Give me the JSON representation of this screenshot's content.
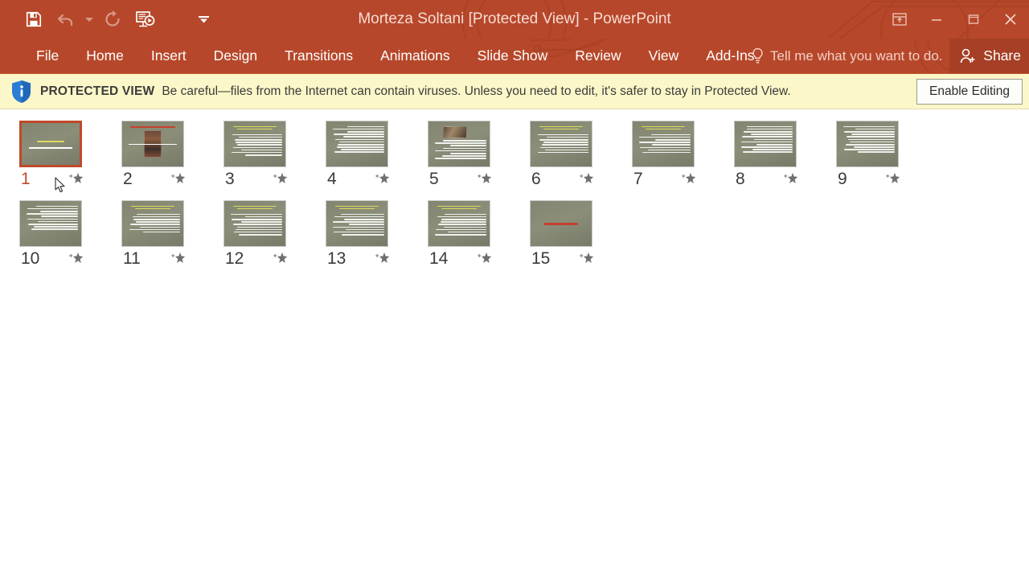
{
  "window": {
    "title": "Morteza Soltani [Protected View] - PowerPoint",
    "accent_color": "#b7472a",
    "share_bg_color": "#a63f25"
  },
  "quick_access": {
    "items": [
      {
        "name": "save-button",
        "icon": "save-icon",
        "label": "Save",
        "enabled": true
      },
      {
        "name": "undo-button",
        "icon": "undo-icon",
        "label": "Undo",
        "enabled": false
      },
      {
        "name": "undo-dropdown",
        "icon": "chevron-down-icon",
        "label": "Undo options",
        "enabled": false
      },
      {
        "name": "redo-button",
        "icon": "redo-icon",
        "label": "Redo",
        "enabled": false
      },
      {
        "name": "start-presentation-button",
        "icon": "presentation-play-icon",
        "label": "Start From Beginning",
        "enabled": true
      },
      {
        "name": "customize-qat-button",
        "icon": "chevron-down-icon",
        "label": "Customize Quick Access Toolbar",
        "enabled": true
      }
    ]
  },
  "window_controls": [
    {
      "name": "ribbon-display-options-button",
      "icon": "ribbon-display-icon",
      "label": "Ribbon Display Options"
    },
    {
      "name": "minimize-button",
      "icon": "minimize-icon",
      "label": "Minimize"
    },
    {
      "name": "restore-button",
      "icon": "restore-icon",
      "label": "Restore Down"
    },
    {
      "name": "close-button",
      "icon": "close-icon",
      "label": "Close"
    }
  ],
  "ribbon": {
    "tabs": [
      {
        "label": "File"
      },
      {
        "label": "Home"
      },
      {
        "label": "Insert"
      },
      {
        "label": "Design"
      },
      {
        "label": "Transitions"
      },
      {
        "label": "Animations"
      },
      {
        "label": "Slide Show"
      },
      {
        "label": "Review"
      },
      {
        "label": "View"
      },
      {
        "label": "Add-Ins"
      }
    ],
    "tell_me": {
      "label": "Tell me what you want to do.",
      "icon": "lightbulb-icon"
    },
    "share": {
      "label": "Share",
      "icon": "share-person-icon"
    }
  },
  "protected_view": {
    "icon": "shield-info-icon",
    "strong_label": "PROTECTED VIEW",
    "message": "Be careful—files from the Internet can contain viruses. Unless you need to edit, it's safer to stay in Protected View.",
    "button_label": "Enable Editing",
    "bar_color": "#fbf7c8"
  },
  "slide_sorter": {
    "selected_slide": 1,
    "star_icon": "animation-star-icon",
    "slides": [
      {
        "number": "1",
        "type": "title",
        "selected": true,
        "lines": 2,
        "has_image": false,
        "title_color": "#e2de5c"
      },
      {
        "number": "2",
        "type": "picture",
        "selected": false,
        "lines": 1,
        "has_image": true,
        "title_color": "#c83c28"
      },
      {
        "number": "3",
        "type": "content",
        "selected": false,
        "lines": 11,
        "has_image": false,
        "title_color": "#e2de5c"
      },
      {
        "number": "4",
        "type": "content",
        "selected": false,
        "lines": 11,
        "has_image": false,
        "title_color": "#ffffff"
      },
      {
        "number": "5",
        "type": "picture-content",
        "selected": false,
        "lines": 8,
        "has_image": true,
        "title_color": "#c83c28"
      },
      {
        "number": "6",
        "type": "content",
        "selected": false,
        "lines": 10,
        "has_image": false,
        "title_color": "#e2de5c"
      },
      {
        "number": "7",
        "type": "content",
        "selected": false,
        "lines": 10,
        "has_image": false,
        "title_color": "#e2de5c"
      },
      {
        "number": "8",
        "type": "content",
        "selected": false,
        "lines": 11,
        "has_image": false,
        "title_color": "#ffffff"
      },
      {
        "number": "9",
        "type": "content",
        "selected": false,
        "lines": 11,
        "has_image": false,
        "title_color": "#ffffff"
      },
      {
        "number": "10",
        "type": "content",
        "selected": false,
        "lines": 10,
        "has_image": false,
        "title_color": "#ffffff"
      },
      {
        "number": "11",
        "type": "content",
        "selected": false,
        "lines": 10,
        "has_image": false,
        "title_color": "#e2de5c"
      },
      {
        "number": "12",
        "type": "content",
        "selected": false,
        "lines": 11,
        "has_image": false,
        "title_color": "#e2de5c"
      },
      {
        "number": "13",
        "type": "content",
        "selected": false,
        "lines": 11,
        "has_image": false,
        "title_color": "#e2de5c"
      },
      {
        "number": "14",
        "type": "content",
        "selected": false,
        "lines": 11,
        "has_image": false,
        "title_color": "#e2de5c"
      },
      {
        "number": "15",
        "type": "closing",
        "selected": false,
        "lines": 1,
        "has_image": false,
        "title_color": "#c83c28"
      }
    ]
  }
}
